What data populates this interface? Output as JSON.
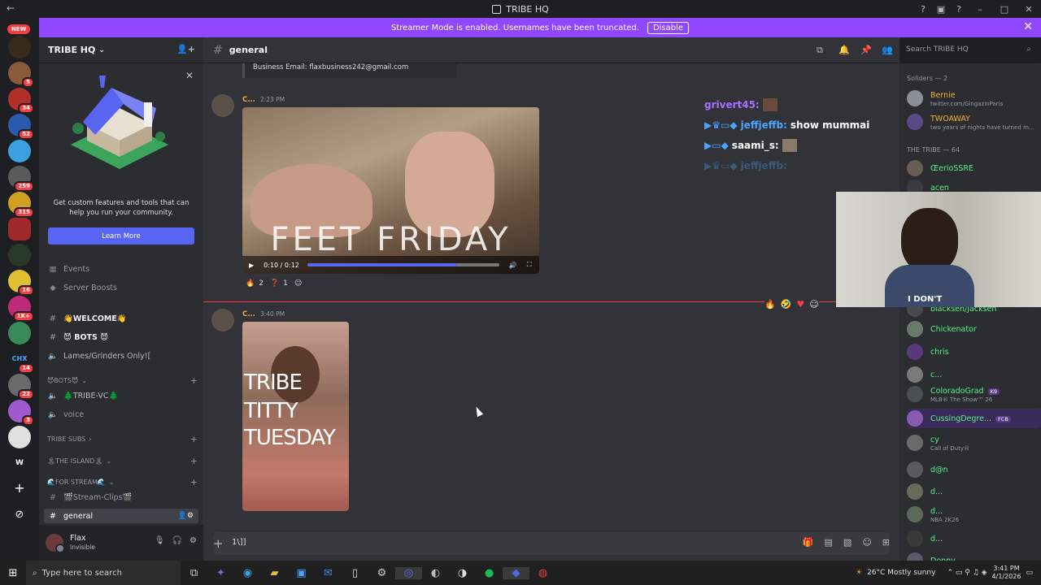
{
  "window": {
    "title": "TRIBE HQ"
  },
  "banner": {
    "text": "Streamer Mode is enabled. Usernames have been truncated.",
    "disable_label": "Disable"
  },
  "rail": {
    "new_label": "NEW",
    "badges": [
      "5",
      "34",
      "52",
      "259",
      "315",
      "16",
      "1K+",
      "14",
      "22",
      "3"
    ],
    "chx_label": "CHX",
    "w_label": "W"
  },
  "server": {
    "name": "TRIBE HQ"
  },
  "promo": {
    "text": "Get custom features and tools that can help you run your community.",
    "button": "Learn More"
  },
  "sidebar": {
    "events": "Events",
    "boosts": "Server Boosts",
    "channels": {
      "welcome": "👋WELCOME👋",
      "bots": "😈 BOTS 😈",
      "lames": "Lames/Grinders Only![",
      "bots_cat": "😈BOTS😈",
      "tribe_vc": "🌲TRIBE-VC🌲",
      "voice": "voice",
      "tribe_subs": "TRIBE SUBS",
      "island": "🏝THE ISLAND🏝",
      "for_stream": "🌊FOR STREAM🌊",
      "stream_clips": "🎬Stream-Clips🎬",
      "general": "general"
    }
  },
  "user": {
    "name": "Flax",
    "status": "Invisible"
  },
  "channel": {
    "name": "general"
  },
  "search": {
    "placeholder": "Search TRIBE HQ"
  },
  "messages": {
    "embed_text": "Business Email: flaxbusiness242@gmail.com",
    "msg1": {
      "author": "C...",
      "time": "2:23 PM",
      "video_caption": "FEET FRIDAY",
      "video_time": "0:10 / 0:12",
      "video_progress": 0.78,
      "reactions": [
        {
          "emoji": "🔥",
          "count": "2"
        },
        {
          "emoji": "❓",
          "count": "1"
        }
      ]
    },
    "msg2": {
      "author": "C...",
      "time": "3:40 PM",
      "img_lines": [
        "TRIBE",
        "TITTY",
        "TUESDAY"
      ]
    }
  },
  "overlay": [
    {
      "user": "grivert45:",
      "msg": "",
      "color": "#a970ff"
    },
    {
      "user": "jeffjeffb:",
      "msg": "show mummai",
      "color": "#4aa3ff"
    },
    {
      "user": "saami_s:",
      "msg": "",
      "color": "#ffffff"
    },
    {
      "user": "jeffjeffb:",
      "msg": "",
      "color": "#4aa3ff"
    }
  ],
  "camera": {
    "shirt_text": "I DON'T"
  },
  "members": {
    "cat1": "Soliders — 2",
    "cat2": "THE TRIBE — 64",
    "list1": [
      {
        "name": "Bernie",
        "status": "twitter.com/GingazinParis",
        "color": "#f0b232",
        "av": "#8a8f99"
      },
      {
        "name": "TWOAWAY",
        "status": "two years of nights have turned m...",
        "color": "#f0b232",
        "av": "#5b4a8a"
      }
    ],
    "list2": [
      {
        "name": "ŒerioSSRE",
        "status": "",
        "color": "#57f287",
        "av": "#6a5d52"
      },
      {
        "name": "acen",
        "status": "",
        "color": "#57f287",
        "av": "#3a3b40"
      },
      {
        "name": "blacksen/Jacksen",
        "status": "",
        "color": "#57f287",
        "av": "#4a4a4a"
      },
      {
        "name": "Chickenator",
        "status": "",
        "color": "#57f287",
        "av": "#6a7a6a"
      },
      {
        "name": "chris",
        "status": "",
        "color": "#57f287",
        "av": "#5a3a7a"
      },
      {
        "name": "c...",
        "status": "",
        "color": "#57f287",
        "av": "#7a7a7a"
      },
      {
        "name": "ColoradoGrad",
        "status": "MLB® The Show™ 26",
        "color": "#57f287",
        "av": "#4a4f55",
        "tag": "K9"
      },
      {
        "name": "CussingDegre...",
        "status": "",
        "color": "#57f287",
        "av": "#8a5ab0",
        "tag": "FCB"
      },
      {
        "name": "cy",
        "status": "Call of Duty®",
        "color": "#57f287",
        "av": "#6a6a6a"
      },
      {
        "name": "d@n",
        "status": "",
        "color": "#57f287",
        "av": "#5a5a5a"
      },
      {
        "name": "d...",
        "status": "",
        "color": "#57f287",
        "av": "#6a6a5a"
      },
      {
        "name": "d...",
        "status": "NBA 2K26",
        "color": "#57f287",
        "av": "#5a6a5a"
      },
      {
        "name": "d...",
        "status": "",
        "color": "#57f287",
        "av": "#3a3a3a"
      },
      {
        "name": "Donny",
        "status": "",
        "color": "#57f287",
        "av": "#5a5a6a"
      }
    ]
  },
  "composer": {
    "text": "1\\]]"
  },
  "taskbar": {
    "search": "Type here to search",
    "weather": "26°C  Mostly sunny",
    "time": "3:41 PM",
    "date": "4/1/2026"
  }
}
